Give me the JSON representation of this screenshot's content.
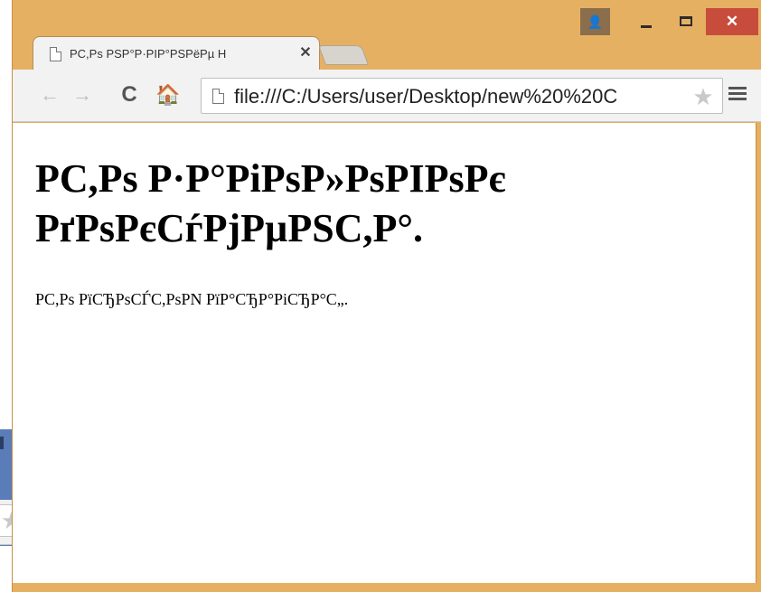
{
  "background_window": {
    "close_glyph": "✕",
    "star_glyph": "★",
    "menu_icon": "hamburger-menu-icon",
    "accent_color": "#5a7cb8"
  },
  "window": {
    "frame_color": "#e6b063",
    "caption": {
      "user_icon": "👤",
      "minimize_icon": "minimize-icon",
      "maximize_icon": "maximize-icon",
      "close_glyph": "✕",
      "close_color": "#c74c3c"
    },
    "tab": {
      "title": "PC,Ps PSP°P·PIP°PSPëPµ H",
      "close_glyph": "✕"
    },
    "toolbar": {
      "back_glyph": "←",
      "forward_glyph": "→",
      "reload_glyph": "C",
      "home_glyph": "🏠",
      "address": "file:///C:/Users/user/Desktop/new%20%20C",
      "star_glyph": "★"
    }
  },
  "page": {
    "heading": "PC,Ps P·P°PiPsP»PsPIPsPє PґPsPєCѓPjPµPSC,P°.",
    "paragraph": "PC,Ps PïCЂPsCЃC,PsPN PïP°CЂP°PiCЂP°C„."
  }
}
